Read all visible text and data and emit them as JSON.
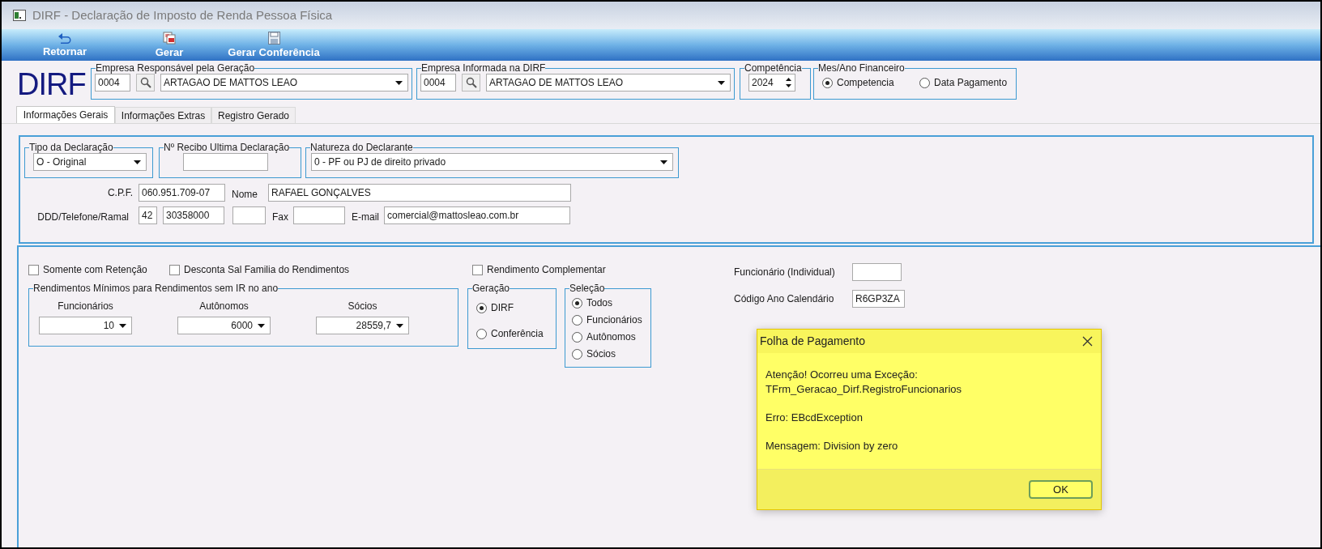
{
  "window": {
    "title": "DIRF - Declaração de Imposto de Renda Pessoa Física"
  },
  "toolbar": [
    {
      "label": "Retornar",
      "kind": "back"
    },
    {
      "label": "Gerar",
      "kind": "generate"
    },
    {
      "label": "Gerar Conferência",
      "kind": "save"
    }
  ],
  "logo": "DIRF",
  "empresa_responsavel": {
    "label": "Empresa Responsável pela Geração",
    "code": "0004",
    "name": "ARTAGAO DE MATTOS LEAO"
  },
  "empresa_informada": {
    "label": "Empresa Informada na DIRF",
    "code": "0004",
    "name": "ARTAGAO DE MATTOS LEAO"
  },
  "competencia": {
    "label": "Competência",
    "value": "2024"
  },
  "mes_ano": {
    "label": "Mes/Ano Financeiro",
    "options": [
      {
        "label": "Competencia",
        "selected": true
      },
      {
        "label": "Data Pagamento",
        "selected": false
      }
    ]
  },
  "tabs": [
    {
      "label": "Informações Gerais",
      "selected": true
    },
    {
      "label": "Informações Extras",
      "selected": false
    },
    {
      "label": "Registro Gerado",
      "selected": false
    }
  ],
  "tipo_declaracao": {
    "label": "Tipo da Declaração",
    "value": "O - Original"
  },
  "recibo": {
    "label": "Nº Recibo Ultima Declaração"
  },
  "natureza": {
    "label": "Natureza do Declarante",
    "value": "0 - PF ou PJ de direito privado"
  },
  "cpf": {
    "label": "C.P.F.",
    "value": "060.951.709-07"
  },
  "nome": {
    "label": "Nome",
    "value": "RAFAEL GONÇALVES"
  },
  "telefone": {
    "label": "DDD/Telefone/Ramal",
    "ddd": "42",
    "number": "30358000"
  },
  "fax": {
    "label": "Fax"
  },
  "email": {
    "label": "E-mail",
    "value": "comercial@mattosleao.com.br"
  },
  "checkboxes": [
    {
      "label": "Somente com Retenção",
      "checked": false
    },
    {
      "label": "Desconta Sal Familia do Rendimentos",
      "checked": false
    },
    {
      "label": "Rendimento Complementar",
      "checked": false
    }
  ],
  "rendimentos_minimos": {
    "label": "Rendimentos Mínimos para Rendimentos sem IR no ano",
    "fields": [
      {
        "label": "Funcionários",
        "value": "10"
      },
      {
        "label": "Autônomos",
        "value": "6000"
      },
      {
        "label": "Sócios",
        "value": "28559,7"
      }
    ]
  },
  "geracao": {
    "label": "Geração",
    "options": [
      {
        "label": "DIRF",
        "selected": true
      },
      {
        "label": "Conferência",
        "selected": false
      }
    ]
  },
  "selecao": {
    "label": "Seleção",
    "options": [
      {
        "label": "Todos",
        "selected": true
      },
      {
        "label": "Funcionários",
        "selected": false
      },
      {
        "label": "Autônomos",
        "selected": false
      },
      {
        "label": "Sócios",
        "selected": false
      }
    ]
  },
  "funcionario_individual": {
    "label": "Funcionário (Individual)"
  },
  "codigo_ano": {
    "label": "Código Ano Calendário",
    "value": "R6GP3ZA"
  },
  "dialog": {
    "title": "Folha de Pagamento",
    "paragraphs": [
      "Atenção! Ocorreu uma Exceção:\nTFrm_Geracao_Dirf.RegistroFuncionarios",
      "Erro: EBcdException",
      "Mensagem: Division by zero"
    ],
    "button": "OK"
  }
}
